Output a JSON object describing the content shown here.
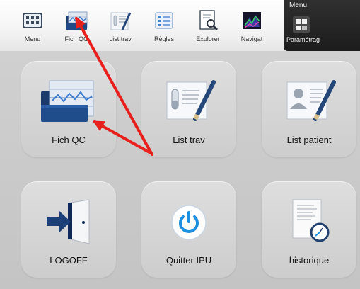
{
  "toolbar": {
    "items": [
      {
        "label": "Menu",
        "icon": "menu-grid-icon"
      },
      {
        "label": "Fich QC",
        "icon": "qc-chart-icon"
      },
      {
        "label": "List trav",
        "icon": "worklist-icon"
      },
      {
        "label": "Règles",
        "icon": "rules-icon"
      },
      {
        "label": "Explorer",
        "icon": "explorer-icon"
      },
      {
        "label": "Navigat",
        "icon": "navigator-icon"
      }
    ],
    "active": {
      "title": "Menu",
      "label": "Paramétrag",
      "icon": "settings-icon"
    }
  },
  "tiles": [
    {
      "label": "Fich QC",
      "icon": "qc-chart-icon"
    },
    {
      "label": "List trav",
      "icon": "worklist-icon"
    },
    {
      "label": "List patient",
      "icon": "patient-list-icon"
    },
    {
      "label": "LOGOFF",
      "icon": "logoff-door-icon"
    },
    {
      "label": "Quitter IPU",
      "icon": "power-icon"
    },
    {
      "label": "historique",
      "icon": "history-document-icon"
    }
  ],
  "colors": {
    "annotation_arrow": "#e8201c",
    "toolbar_active_bg": "#1f1f1f",
    "power_blue": "#1b8fe0"
  }
}
